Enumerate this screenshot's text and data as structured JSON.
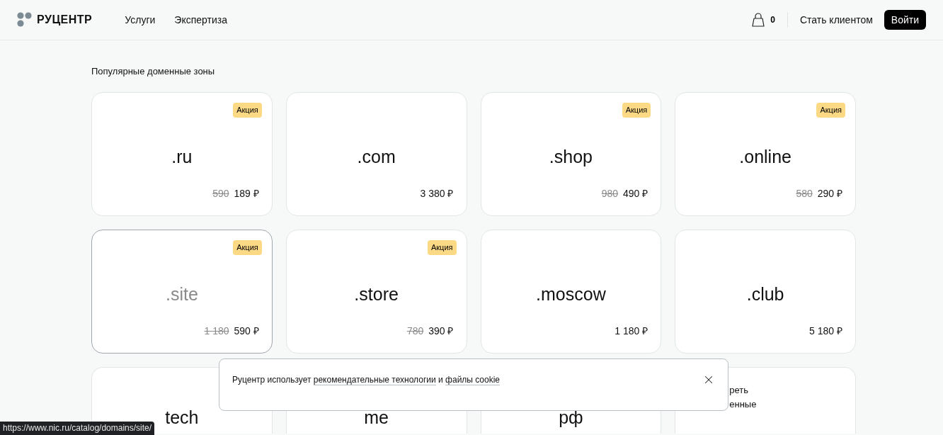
{
  "header": {
    "logo": "РУЦЕНТР",
    "nav": [
      {
        "label": "Услуги"
      },
      {
        "label": "Экспертиза"
      }
    ],
    "cart_count": "0",
    "signup_link": "Стать клиентом",
    "login_button": "Войти"
  },
  "section_title": "Популярные доменные зоны",
  "domains": [
    {
      "name": ".ru",
      "badge": "Акция",
      "old_price": "590",
      "price": "189 ₽",
      "hovered": false
    },
    {
      "name": ".com",
      "price": "3 380 ₽",
      "hovered": false
    },
    {
      "name": ".shop",
      "badge": "Акция",
      "old_price": "980",
      "price": "490 ₽",
      "hovered": false
    },
    {
      "name": ".online",
      "badge": "Акция",
      "old_price": "580",
      "price": "290 ₽",
      "hovered": false
    },
    {
      "name": ".site",
      "badge": "Акция",
      "old_price": "1 180",
      "price": "590 ₽",
      "hovered": true
    },
    {
      "name": ".store",
      "badge": "Акция",
      "old_price": "780",
      "price": "390 ₽",
      "hovered": false
    },
    {
      "name": ".moscow",
      "price": "1 180 ₽",
      "hovered": false
    },
    {
      "name": ".club",
      "price": "5 180 ₽",
      "hovered": false
    }
  ],
  "partial_cards": [
    {
      "kind": "domain",
      "name": "tech"
    },
    {
      "kind": "domain",
      "name": "me"
    },
    {
      "kind": "domain",
      "name": "рф"
    },
    {
      "kind": "link",
      "lines": [
        "реть",
        "енные"
      ]
    }
  ],
  "cookie_banner": {
    "text_before": "Руцентр использует",
    "link_1": "рекомендательные технологии",
    "text_between": "и",
    "link_2": "файлы cookie"
  },
  "status_url": "https://www.nic.ru/catalog/domains/site/"
}
